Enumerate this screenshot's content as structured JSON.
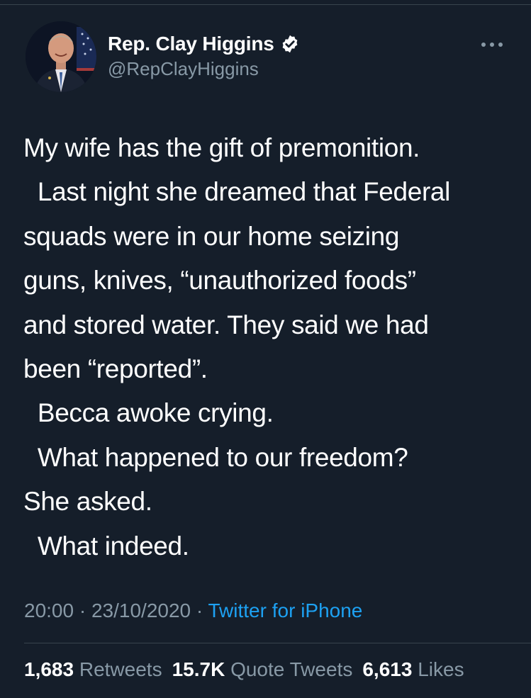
{
  "author": {
    "display_name": "Rep. Clay Higgins",
    "handle": "@RepClayHiggins",
    "verified_icon": "verified-badge-icon",
    "avatar_icon": "profile-photo"
  },
  "more_icon": "more-options-icon",
  "tweet": {
    "lines": [
      "My wife has the gift of premonition.",
      "  Last night she dreamed that Federal",
      "squads were in our home seizing",
      "guns, knives, “unauthorized foods”",
      "and stored water. They said we had",
      "been “reported”.",
      "  Becca awoke crying.",
      "  What happened to our freedom?",
      "She asked.",
      "  What indeed."
    ]
  },
  "meta": {
    "time": "20:00",
    "sep1": " · ",
    "date": "23/10/2020",
    "sep2": " · ",
    "source": "Twitter for iPhone"
  },
  "stats": {
    "retweets_count": "1,683",
    "retweets_label": "Retweets",
    "quotes_count": "15.7K",
    "quotes_label": "Quote Tweets",
    "likes_count": "6,613",
    "likes_label": "Likes"
  },
  "colors": {
    "background": "#151e2a",
    "text": "#ffffff",
    "muted": "#8899a6",
    "link": "#1da1f2",
    "divider": "#38444d"
  }
}
